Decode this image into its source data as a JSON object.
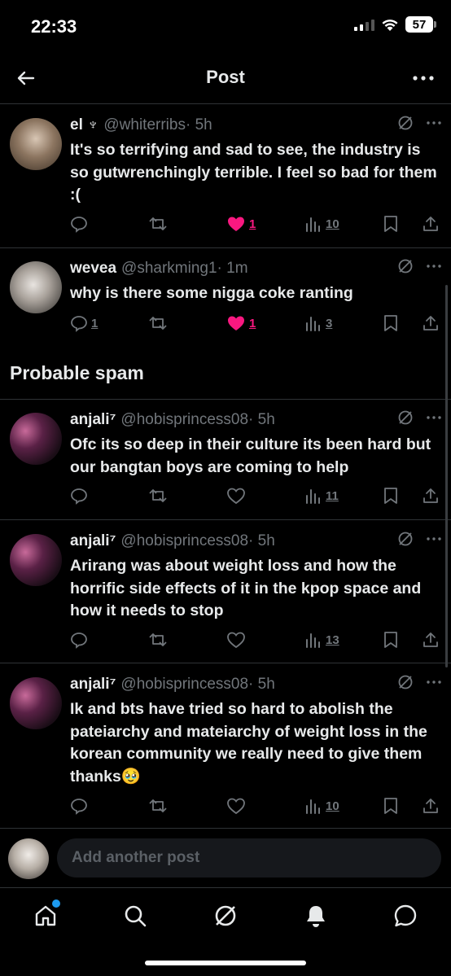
{
  "status_bar": {
    "time": "22:33",
    "battery": "57"
  },
  "header": {
    "title": "Post"
  },
  "posts": [
    {
      "name": "el ♆",
      "handle": "@whiterribs",
      "time": "· 5h",
      "text": "It's so terrifying and sad to see, the industry is so gutwrenchingly terrible. I feel so bad for them :(",
      "reply_count": "",
      "like_count": "1",
      "liked": true,
      "view_count": "10"
    },
    {
      "name": "wevea",
      "handle": "@sharkming1",
      "time": "· 1m",
      "text": "why is there some nigga coke ranting",
      "reply_count": "1",
      "like_count": "1",
      "liked": true,
      "view_count": "3"
    },
    {
      "name": "anjali⁷",
      "handle": "@hobisprincess08",
      "time": "· 5h",
      "text": "Ofc its so deep in their culture its been hard but our bangtan boys are coming to help",
      "reply_count": "",
      "like_count": "",
      "liked": false,
      "view_count": "11"
    },
    {
      "name": "anjali⁷",
      "handle": "@hobisprincess08",
      "time": "· 5h",
      "text": "Arirang was about weight loss and how the horrific side effects of it in the kpop space and how it needs to stop",
      "reply_count": "",
      "like_count": "",
      "liked": false,
      "view_count": "13"
    },
    {
      "name": "anjali⁷",
      "handle": "@hobisprincess08",
      "time": "· 5h",
      "text": "Ik and bts have tried so hard to abolish the pateiarchy and mateiarchy of weight loss in the korean community we really need to give them thanks🥹",
      "reply_count": "",
      "like_count": "",
      "liked": false,
      "view_count": "10"
    }
  ],
  "section": {
    "probable_spam": "Probable spam"
  },
  "reply": {
    "placeholder": "Add another post"
  },
  "colors": {
    "like": "#f91880",
    "muted": "#71767b",
    "accent": "#1d9bf0"
  },
  "icons": [
    "back-arrow-icon",
    "more-icon",
    "grok-icon",
    "reply-icon",
    "repost-icon",
    "heart-icon",
    "views-icon",
    "bookmark-icon",
    "share-icon",
    "home-icon",
    "search-icon",
    "notifications-icon",
    "messages-icon"
  ]
}
